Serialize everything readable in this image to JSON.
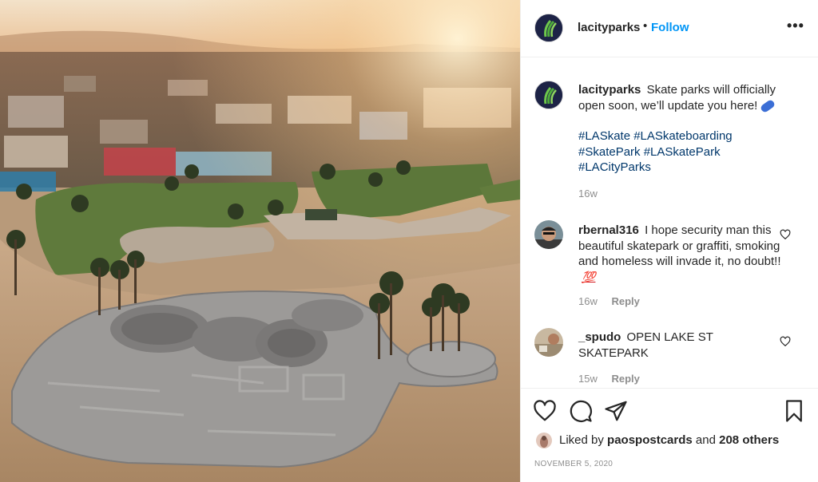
{
  "post": {
    "author": "lacityparks",
    "dot": "•",
    "follow_label": "Follow",
    "more_label": "•••"
  },
  "caption": {
    "username": "lacityparks",
    "text": "Skate parks will officially open soon, we’ll update you here!",
    "emoji": "skateboard-emoji",
    "hashtags": [
      "#LASkate",
      "#LASkateboarding",
      "#SkatePark",
      "#LASkatePark",
      "#LACityParks"
    ],
    "time": "16w"
  },
  "comments": [
    {
      "username": "rbernal316",
      "text": "I hope security man this beautiful skatepark or graffiti, smoking and homeless will invade it, no doubt!!",
      "emoji": "💯",
      "time": "16w",
      "reply_label": "Reply"
    },
    {
      "username": "_spudo",
      "text": "OPEN LAKE ST SKATEPARK",
      "time": "15w",
      "reply_label": "Reply"
    }
  ],
  "likes": {
    "prefix": "Liked by",
    "user": "paospostcards",
    "conj": "and",
    "others": "208 others"
  },
  "date": "NOVEMBER 5, 2020",
  "icons": [
    "heart-icon",
    "comment-icon",
    "share-icon",
    "bookmark-icon",
    "more-icon"
  ],
  "colors": {
    "link_blue": "#0095f6",
    "hashtag": "#00376b",
    "muted": "#8e8e8e",
    "text": "#262626"
  }
}
